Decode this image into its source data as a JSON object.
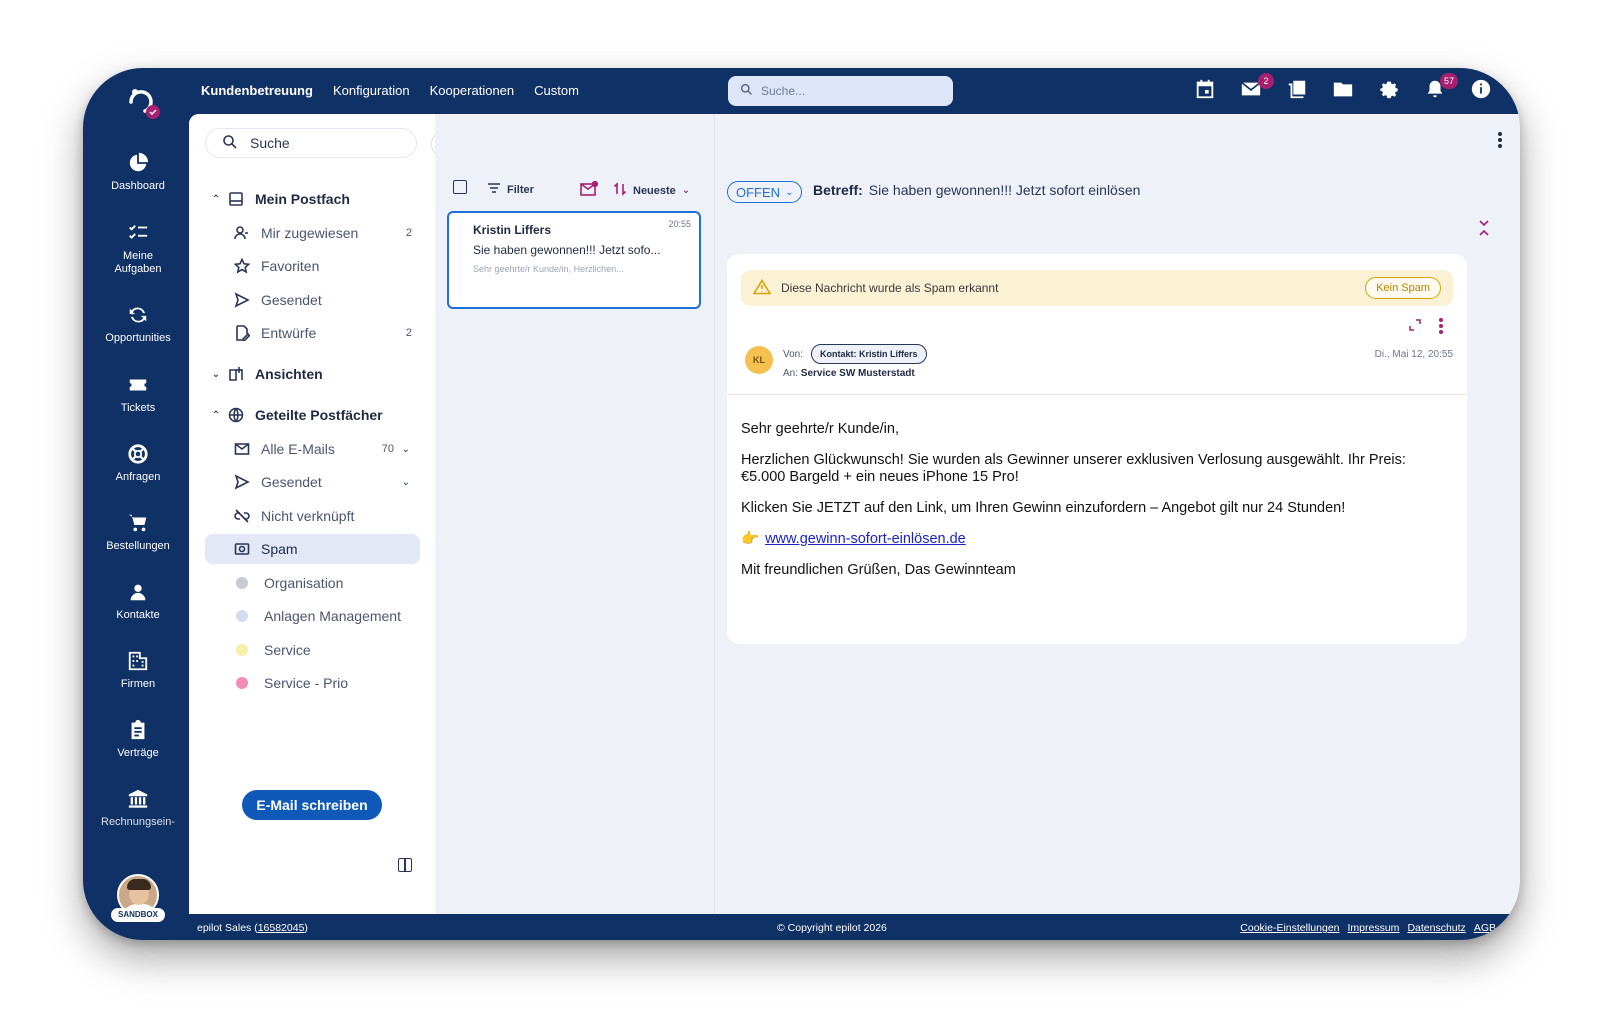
{
  "topnav": {
    "items": [
      "Kundenbetreuung",
      "Konfiguration",
      "Kooperationen",
      "Custom"
    ],
    "search_placeholder": "Suche...",
    "badges": {
      "mail": "2",
      "notifications": "57"
    }
  },
  "leftnav": {
    "items": [
      {
        "label": "Dashboard",
        "icon": "pie-chart-icon"
      },
      {
        "label": "Meine Aufgaben",
        "icon": "checklist-icon"
      },
      {
        "label": "Opportunities",
        "icon": "sync-icon"
      },
      {
        "label": "Tickets",
        "icon": "ticket-icon"
      },
      {
        "label": "Anfragen",
        "icon": "lifebuoy-icon"
      },
      {
        "label": "Bestellungen",
        "icon": "cart-icon"
      },
      {
        "label": "Kontakte",
        "icon": "person-icon"
      },
      {
        "label": "Firmen",
        "icon": "building-icon"
      },
      {
        "label": "Verträge",
        "icon": "clipboard-icon"
      },
      {
        "label": "Rechnungsein-heiten",
        "icon": "bank-icon"
      }
    ],
    "sandbox_label": "SANDBOX"
  },
  "folders": {
    "search_placeholder": "Suche",
    "mein_postfach": "Mein Postfach",
    "mir_zugewiesen": {
      "label": "Mir zugewiesen",
      "count": "2"
    },
    "favoriten": "Favoriten",
    "gesendet": "Gesendet",
    "entwuerfe": {
      "label": "Entwürfe",
      "count": "2"
    },
    "ansichten": "Ansichten",
    "geteilte": "Geteilte Postfächer",
    "alle_emails": {
      "label": "Alle E-Mails",
      "count": "70"
    },
    "gesendet_shared": "Gesendet",
    "nicht_verknuepft": "Nicht verknüpft",
    "spam": "Spam",
    "labels": [
      {
        "label": "Organisation",
        "color": "#c8cbd3"
      },
      {
        "label": "Anlagen Management",
        "color": "#d3dcf3"
      },
      {
        "label": "Service",
        "color": "#f7f0a8"
      },
      {
        "label": "Service - Prio",
        "color": "#f08db8"
      }
    ],
    "compose_label": "E-Mail schreiben"
  },
  "msglist": {
    "filter_label": "Filter",
    "sort_label": "Neueste",
    "mail": {
      "from": "Kristin Liffers",
      "time": "20:55",
      "subject": "Sie haben gewonnen!!! Jetzt sofo...",
      "preview": "Sehr geehrte/r Kunde/in, Herzlichen..."
    }
  },
  "reader": {
    "status": "OFFEN",
    "subject_label": "Betreff:",
    "subject": "Sie haben gewonnen!!! Jetzt sofort einlösen",
    "spam_notice": "Diese Nachricht wurde als Spam erkannt",
    "not_spam_label": "Kein Spam",
    "avatar_initials": "KL",
    "from_label": "Von:",
    "contact_chip": "Kontakt: Kristin Liffers",
    "to_label": "An:",
    "to": "Service SW Musterstadt",
    "date": "Di., Mai 12, 20:55",
    "body": {
      "greeting": "Sehr geehrte/r Kunde/in,",
      "p1": "Herzlichen Glückwunsch! Sie wurden als Gewinner unserer exklusiven Verlosung ausgewählt. Ihr Preis: €5.000 Bargeld + ein neues iPhone 15 Pro!",
      "p2": "Klicken Sie JETZT auf den Link, um Ihren Gewinn einzufordern – Angebot gilt nur 24 Stunden!",
      "link_emoji": "👉",
      "link": "www.gewinn-sofort-einlösen.de",
      "closing": "Mit freundlichen Grüßen, Das Gewinnteam"
    }
  },
  "footer": {
    "org": "epilot Sales (",
    "org_id": "16582045",
    "org_close": ")",
    "copyright": "© Copyright epilot 2026",
    "links": [
      "Cookie-Einstellungen",
      "Impressum",
      "Datenschutz",
      "AGB"
    ]
  }
}
